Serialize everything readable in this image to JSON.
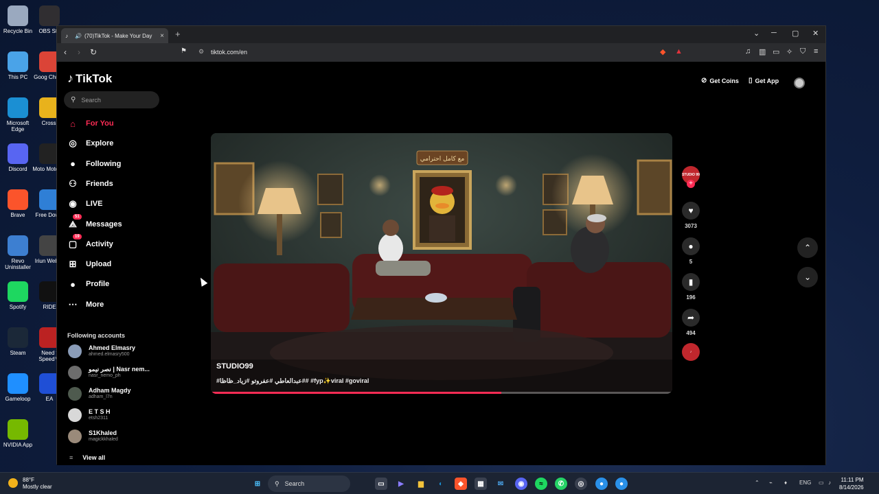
{
  "desktop": {
    "icons": [
      {
        "label": "Recycle Bin",
        "icon": "recycle-bin-icon",
        "color": "#9aa9bf"
      },
      {
        "label": "This PC",
        "icon": "monitor-icon",
        "color": "#4aa3e8"
      },
      {
        "label": "Microsoft Edge",
        "icon": "edge-icon",
        "color": "#1b8fd3"
      },
      {
        "label": "Discord",
        "icon": "discord-icon",
        "color": "#5865f2"
      },
      {
        "label": "Brave",
        "icon": "brave-icon",
        "color": "#fb542b"
      },
      {
        "label": "Revo Uninstaller",
        "icon": "revo-icon",
        "color": "#3d7fd1"
      },
      {
        "label": "Spotify",
        "icon": "spotify-icon",
        "color": "#1ed760"
      },
      {
        "label": "Steam",
        "icon": "steam-icon",
        "color": "#1b2838"
      },
      {
        "label": "Gameloop",
        "icon": "gameloop-icon",
        "color": "#1f8fff"
      },
      {
        "label": "NVIDIA App",
        "icon": "nvidia-icon",
        "color": "#76b900"
      }
    ],
    "icons2": [
      {
        "label": "OBS Stu",
        "icon": "obs-icon",
        "color": "#302e31"
      },
      {
        "label": "Goog Chrom",
        "icon": "chrome-icon",
        "color": "#db4437"
      },
      {
        "label": "Crossl",
        "icon": "crossl-icon",
        "color": "#e8b21c"
      },
      {
        "label": "Moto MotoGP",
        "icon": "motogp-icon",
        "color": "#222"
      },
      {
        "label": "Free Downl",
        "icon": "download-icon",
        "color": "#2f7fd6"
      },
      {
        "label": "Iriun Webca",
        "icon": "webcam-icon",
        "color": "#444"
      },
      {
        "label": "RIDE",
        "icon": "ride-icon",
        "color": "#111"
      },
      {
        "label": "Need f Speed™",
        "icon": "nfs-icon",
        "color": "#b22"
      },
      {
        "label": "EA",
        "icon": "ea-icon",
        "color": "#1f4fd6"
      }
    ]
  },
  "browser": {
    "tab_title": "(70)TikTok - Make Your Day",
    "url": "tiktok.com/en"
  },
  "tiktok": {
    "logo": "TikTok",
    "search_placeholder": "Search",
    "nav": [
      {
        "label": "For You",
        "icon": "home-icon",
        "active": true
      },
      {
        "label": "Explore",
        "icon": "compass-icon"
      },
      {
        "label": "Following",
        "icon": "following-avatar-icon"
      },
      {
        "label": "Friends",
        "icon": "friends-icon"
      },
      {
        "label": "LIVE",
        "icon": "live-icon"
      },
      {
        "label": "Messages",
        "icon": "messages-icon",
        "badge": "51"
      },
      {
        "label": "Activity",
        "icon": "activity-icon",
        "badge": "19"
      },
      {
        "label": "Upload",
        "icon": "upload-icon"
      },
      {
        "label": "Profile",
        "icon": "profile-icon"
      },
      {
        "label": "More",
        "icon": "more-icon"
      }
    ],
    "following_title": "Following accounts",
    "accounts": [
      {
        "name": "Ahmed Elmasry",
        "handle": "ahmed.elmasry500"
      },
      {
        "name": "نصر نيمو | Nasr nem...",
        "handle": "nasr_nemo_ph"
      },
      {
        "name": "Adham Magdy",
        "handle": "adham_l7n"
      },
      {
        "name": "E T S H",
        "handle": "etsh2311"
      },
      {
        "name": "S1Khaled",
        "handle": "magickkhaled"
      }
    ],
    "view_all": "View all",
    "get_coins": "Get Coins",
    "get_app": "Get App",
    "video": {
      "author": "STUDIO99",
      "caption": "#عبدالعاطي #عفروتو #زياد_ظاظا## #fyp✨viral #goviral",
      "sign_text": "مع كامل احترامي",
      "progress": 0.63
    },
    "actions": {
      "likes": "3073",
      "comments": "5",
      "saves": "196",
      "shares": "494",
      "creator_badge": "STUDIO 99"
    }
  },
  "taskbar": {
    "temp": "88°F",
    "weather": "Mostly clear",
    "search": "Search",
    "lang": "ENG",
    "time": "11:11 PM",
    "date": "8/14/2026"
  },
  "colors": {
    "accent": "#fe2c55"
  }
}
